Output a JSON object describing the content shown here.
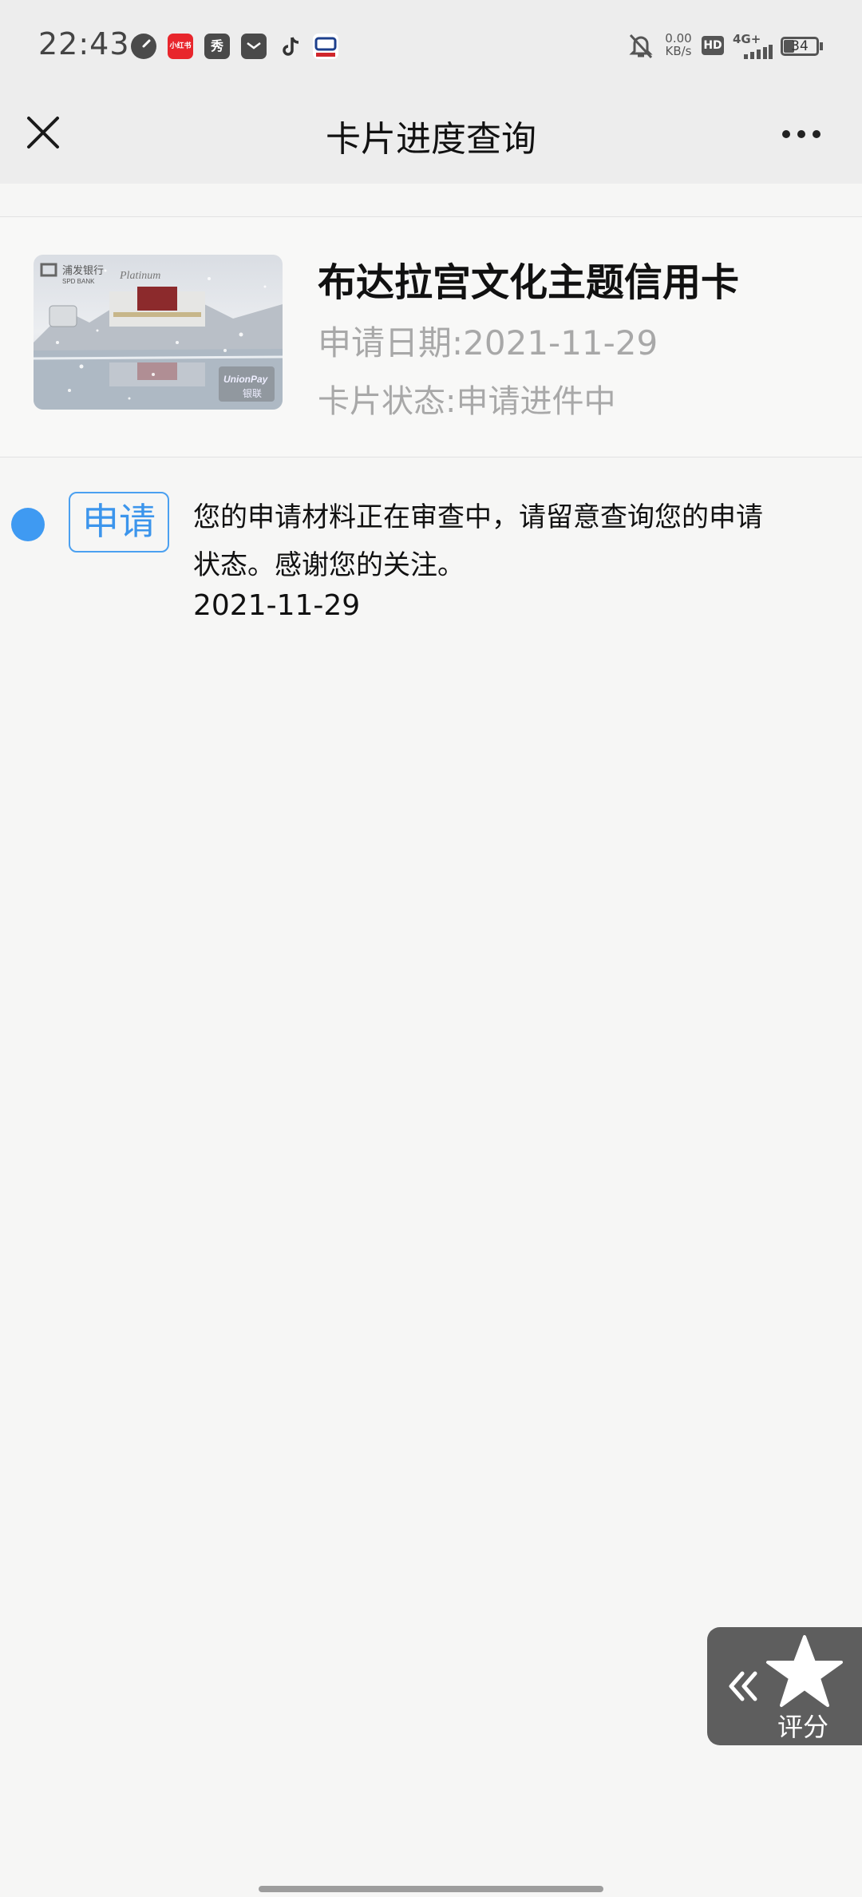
{
  "status_bar": {
    "time": "22:43",
    "app_icons": [
      "speedometer-icon",
      "xiaohongshu-icon",
      "xiu-icon",
      "mail-icon",
      "tiktok-icon",
      "spdb-icon"
    ],
    "app_icon_texts": [
      "小红书",
      "秀"
    ],
    "net_speed_value": "0.00",
    "net_speed_unit": "KB/s",
    "hd": "HD",
    "network": "4G+",
    "battery": "34"
  },
  "header": {
    "title": "卡片进度查询"
  },
  "card": {
    "name": "布达拉宫文化主题信用卡",
    "apply_date": "申请日期:2021-11-29",
    "status": "卡片状态:申请进件中",
    "image_bank_text": "浦发银行",
    "image_bank_en": "SPD BANK",
    "image_tier": "Platinum",
    "image_network": "UnionPay",
    "image_network_cn": "银联"
  },
  "timeline": [
    {
      "tag": "申请",
      "text": "您的申请材料正在审查中，请留意查询您的申请状态。感谢您的关注。",
      "date": "2021-11-29"
    }
  ],
  "rating": {
    "label": "评分"
  },
  "colors": {
    "accent": "#3f9af2",
    "muted_text": "#a8a8a8",
    "header_bg": "#ededed",
    "float_bg": "#5e5e5e"
  }
}
